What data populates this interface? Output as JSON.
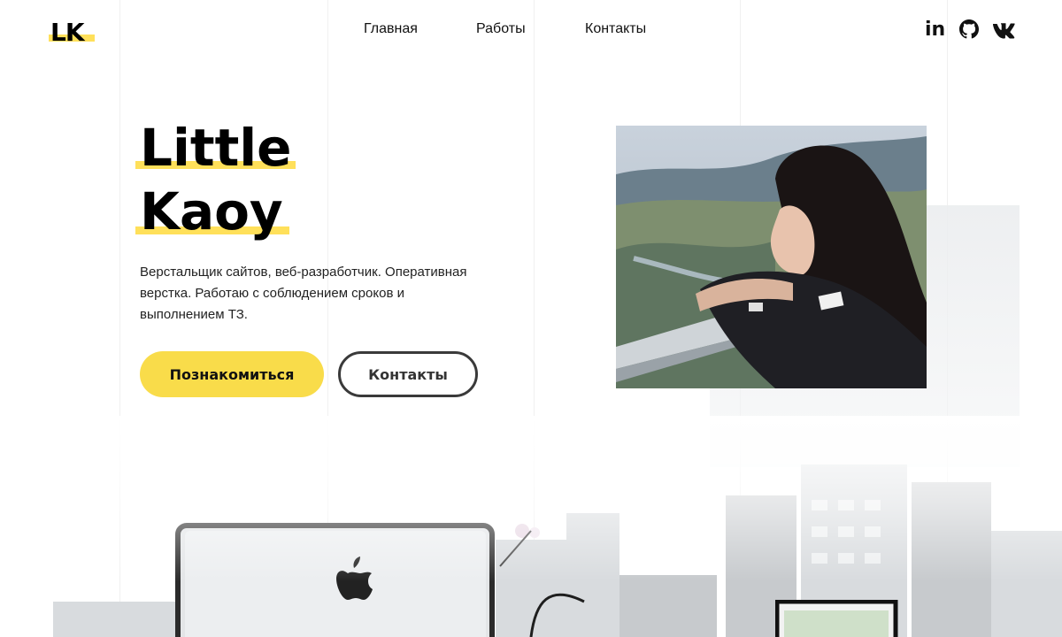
{
  "header": {
    "logo": "LK",
    "nav": [
      {
        "label": "Главная"
      },
      {
        "label": "Работы"
      },
      {
        "label": "Контакты"
      }
    ],
    "social": [
      {
        "icon": "linkedin-icon",
        "text": "in"
      },
      {
        "icon": "github-icon"
      },
      {
        "icon": "vk-icon"
      }
    ]
  },
  "hero": {
    "title_line1": "Little",
    "title_line2": "Kaoy",
    "description": "Верстальщик сайтов, веб-разработчик. Оперативная верстка. Работаю с соблюдением сроков и выполнением ТЗ.",
    "primary_button": "Познакомиться",
    "secondary_button": "Контакты"
  },
  "colors": {
    "accent": "#f9dc4a",
    "text": "#111111",
    "outline": "#3a3a3a"
  }
}
